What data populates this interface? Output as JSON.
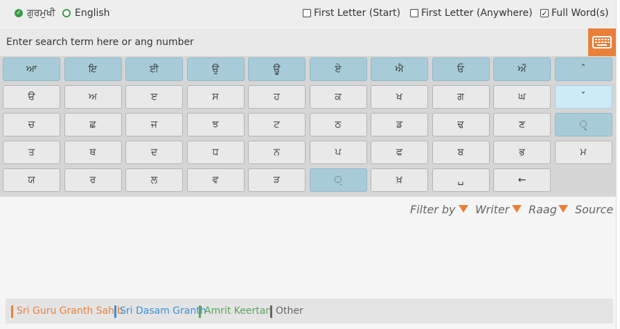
{
  "top": {
    "script_options": [
      {
        "label": "ਗੁਰਮੁਖੀ",
        "selected": true
      },
      {
        "label": "English",
        "selected": false
      }
    ],
    "match_options": [
      {
        "label": "First Letter (Start)",
        "checked": false
      },
      {
        "label": "First Letter (Anywhere)",
        "checked": false
      },
      {
        "label": "Full Word(s)",
        "checked": true
      }
    ]
  },
  "search": {
    "placeholder": "Enter search term here or ang number",
    "keyboard_icon": "keyboard-icon"
  },
  "keyboard": {
    "rows": [
      [
        "ਆ",
        "ਇ",
        "ਈ",
        "ਉ",
        "ਊ",
        "ਏ",
        "ਐ",
        "ਓ",
        "ਔ",
        "ˆ"
      ],
      [
        "ੳ",
        "ਅ",
        "ੲ",
        "ਸ",
        "ਹ",
        "ਕ",
        "ਖ",
        "ਗ",
        "ਘ",
        "ˇ"
      ],
      [
        "ਚ",
        "ਛ",
        "ਜ",
        "ਝ",
        "ਟ",
        "ਠ",
        "ਡ",
        "ਢ",
        "ਣ",
        "ੑ"
      ],
      [
        "ਤ",
        "ਥ",
        "ਦ",
        "ਧ",
        "ਨ",
        "ਪ",
        "ਫ",
        "ਬ",
        "ਭ",
        "ਮ"
      ],
      [
        "ਯ",
        "ਰ",
        "ਲ",
        "ਵ",
        "ੜ",
        "਼",
        "ਖ਼",
        "␣",
        "←"
      ]
    ],
    "colors": {
      "vowel": "#a7cbd9",
      "highlight": "#cdeaf7",
      "normal": "#e9e9e9"
    }
  },
  "filters": {
    "label": "Filter by",
    "items": [
      "Writer",
      "Raag",
      "Source"
    ],
    "accent": "#e8803a"
  },
  "sources": [
    {
      "label": "Sri Guru Granth Sahib",
      "color": "#e8803a"
    },
    {
      "label": "Sri Dasam Granth",
      "color": "#3a8fd6"
    },
    {
      "label": "Amrit Keertan",
      "color": "#5aa45a"
    },
    {
      "label": "Other",
      "color": "#666666"
    }
  ]
}
